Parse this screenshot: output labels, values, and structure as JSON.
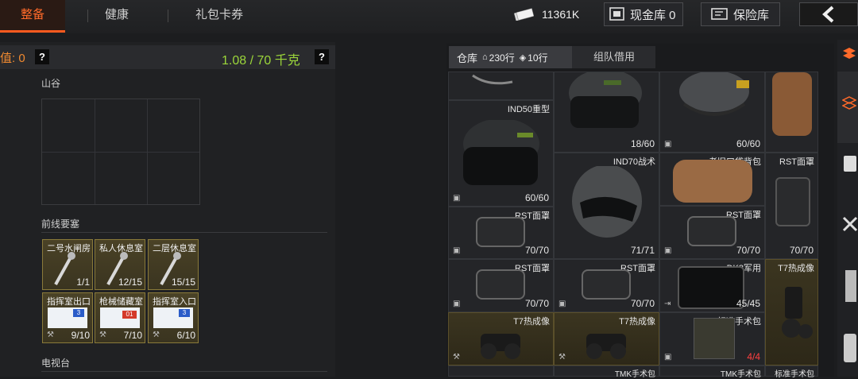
{
  "top_tabs": [
    {
      "label": "整备",
      "active": true
    },
    {
      "label": "健康",
      "active": false
    },
    {
      "label": "礼包卡券",
      "active": false
    }
  ],
  "currency": {
    "money": "11361K",
    "cash_label": "现金库 0",
    "safe_label": "保险库"
  },
  "left": {
    "value_label": "值: 0",
    "help": "?",
    "weight": "1.08 / 70 千克",
    "sections": {
      "valley": "山谷",
      "frontline": "前线要塞",
      "tv": "电视台"
    },
    "keys": [
      {
        "name": "二号水闸房",
        "count": "1/1",
        "kind": "key"
      },
      {
        "name": "私人休息室",
        "count": "12/15",
        "kind": "key"
      },
      {
        "name": "二层休息室",
        "count": "15/15",
        "kind": "key"
      },
      {
        "name": "指挥室出口",
        "count": "9/10",
        "kind": "card",
        "card_num": "3"
      },
      {
        "name": "枪械储藏室",
        "count": "7/10",
        "kind": "card",
        "card_num": "01"
      },
      {
        "name": "指挥室入口",
        "count": "6/10",
        "kind": "card",
        "card_num": "3"
      }
    ]
  },
  "inventory": {
    "tab_storage": "仓库",
    "rows_label": "230行",
    "rows2_label": "10行",
    "tab_team": "组队借用",
    "items": [
      {
        "name": "",
        "count": "",
        "gold": false
      },
      {
        "name": "",
        "count": "18/60",
        "gold": false
      },
      {
        "name": "",
        "count": "60/60",
        "gold": false
      },
      {
        "name": "",
        "count": "",
        "gold": false
      },
      {
        "name": "IND50重型",
        "count": "60/60",
        "gold": false
      },
      {
        "name": "IND70战术",
        "count": "71/71",
        "gold": false
      },
      {
        "name": "老旧口袋背包",
        "count": "",
        "gold": false
      },
      {
        "name": "RST面罩",
        "count": "70/70",
        "gold": false
      },
      {
        "name": "RST面罩",
        "count": "70/70",
        "gold": false
      },
      {
        "name": "RST面罩",
        "count": "70/70",
        "gold": false
      },
      {
        "name": "RST面罩",
        "count": "70/70",
        "gold": false
      },
      {
        "name": "RST面罩",
        "count": "70/70",
        "gold": false
      },
      {
        "name": "DK8军用",
        "count": "45/45",
        "gold": false
      },
      {
        "name": "T7热成像",
        "count": "",
        "gold": true
      },
      {
        "name": "T7热成像",
        "count": "",
        "gold": true
      },
      {
        "name": "T7热成像",
        "count": "",
        "gold": true
      },
      {
        "name": "标准手术包",
        "count": "4/4",
        "gold": false,
        "red": true
      },
      {
        "name": "TMK手术包",
        "count": "",
        "gold": false
      },
      {
        "name": "TMK手术包",
        "count": "",
        "gold": false
      },
      {
        "name": "标准手术包",
        "count": "",
        "gold": false
      }
    ]
  }
}
